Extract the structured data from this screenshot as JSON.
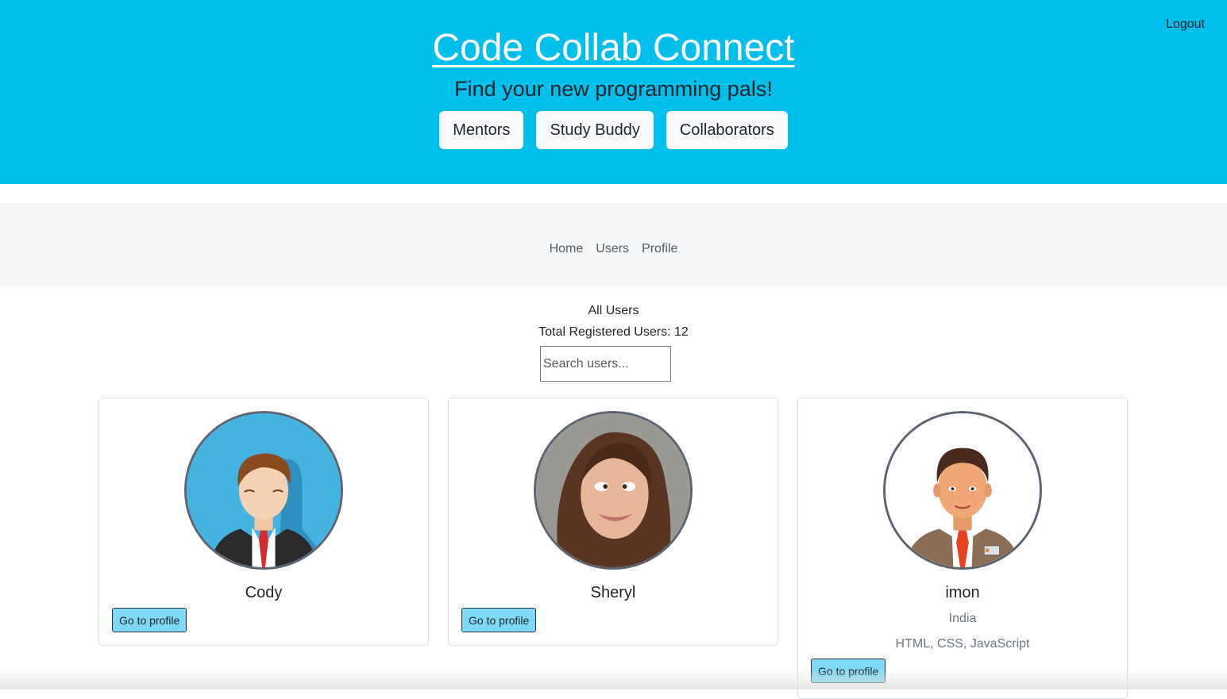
{
  "header": {
    "logout_label": "Logout",
    "title": "Code Collab Connect",
    "tagline": "Find your new programming pals!",
    "categories": [
      "Mentors",
      "Study Buddy",
      "Collaborators"
    ],
    "background_color": "#00bfea"
  },
  "nav": {
    "links": [
      "Home",
      "Users",
      "Profile"
    ]
  },
  "users_section": {
    "title": "All Users",
    "count_text": "Total Registered Users: 12",
    "search_placeholder": "Search users..."
  },
  "cards": [
    {
      "name": "Cody",
      "avatar": "cartoon-businessman-avatar",
      "button_label": "Go to profile"
    },
    {
      "name": "Sheryl",
      "avatar": "woman-photo-avatar",
      "button_label": "Go to profile"
    },
    {
      "name": "imon",
      "location": "India",
      "skills": "HTML, CSS, JavaScript",
      "avatar": "cartoon-man-red-tie-avatar",
      "button_label": "Go to profile"
    }
  ],
  "colors": {
    "button_accent": "#7dd9f6",
    "navbar_bg": "#f7f8f9"
  }
}
